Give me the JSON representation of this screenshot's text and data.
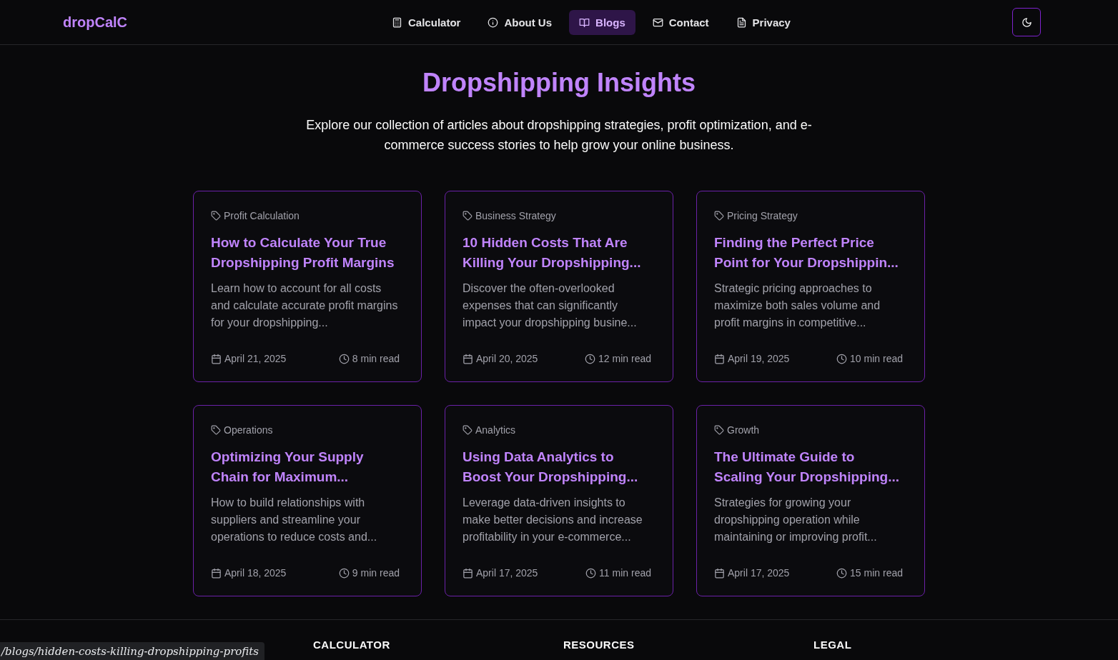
{
  "header": {
    "logo": "dropCalC",
    "nav": [
      {
        "label": "Calculator",
        "selected": false
      },
      {
        "label": "About Us",
        "selected": false
      },
      {
        "label": "Blogs",
        "selected": true
      },
      {
        "label": "Contact",
        "selected": false
      },
      {
        "label": "Privacy",
        "selected": false
      }
    ]
  },
  "hero": {
    "title": "Dropshipping Insights",
    "subtitle": "Explore our collection of articles about dropshipping strategies, profit optimization, and e-commerce success stories to help grow your online business."
  },
  "posts": [
    {
      "category": "Profit Calculation",
      "title": "How to Calculate Your True Dropshipping Profit Margins",
      "excerpt": "Learn how to account for all costs and calculate accurate profit margins for your dropshipping...",
      "date": "April 21, 2025",
      "read_time": "8 min read"
    },
    {
      "category": "Business Strategy",
      "title": "10 Hidden Costs That Are Killing Your Dropshipping...",
      "excerpt": "Discover the often-overlooked expenses that can significantly impact your dropshipping busine...",
      "date": "April 20, 2025",
      "read_time": "12 min read"
    },
    {
      "category": "Pricing Strategy",
      "title": "Finding the Perfect Price Point for Your Dropshippin...",
      "excerpt": "Strategic pricing approaches to maximize both sales volume and profit margins in competitive...",
      "date": "April 19, 2025",
      "read_time": "10 min read"
    },
    {
      "category": "Operations",
      "title": "Optimizing Your Supply Chain for Maximum...",
      "excerpt": "How to build relationships with suppliers and streamline your operations to reduce costs and...",
      "date": "April 18, 2025",
      "read_time": "9 min read"
    },
    {
      "category": "Analytics",
      "title": "Using Data Analytics to Boost Your Dropshipping...",
      "excerpt": "Leverage data-driven insights to make better decisions and increase profitability in your e-commerce...",
      "date": "April 17, 2025",
      "read_time": "11 min read"
    },
    {
      "category": "Growth",
      "title": "The Ultimate Guide to Scaling Your Dropshipping...",
      "excerpt": "Strategies for growing your dropshipping operation while maintaining or improving profit...",
      "date": "April 17, 2025",
      "read_time": "15 min read"
    }
  ],
  "footer": {
    "headings": [
      "CALCULATOR",
      "RESOURCES",
      "LEGAL"
    ]
  },
  "status_bar": {
    "url": "/blogs/hidden-costs-killing-dropshipping-profits"
  }
}
